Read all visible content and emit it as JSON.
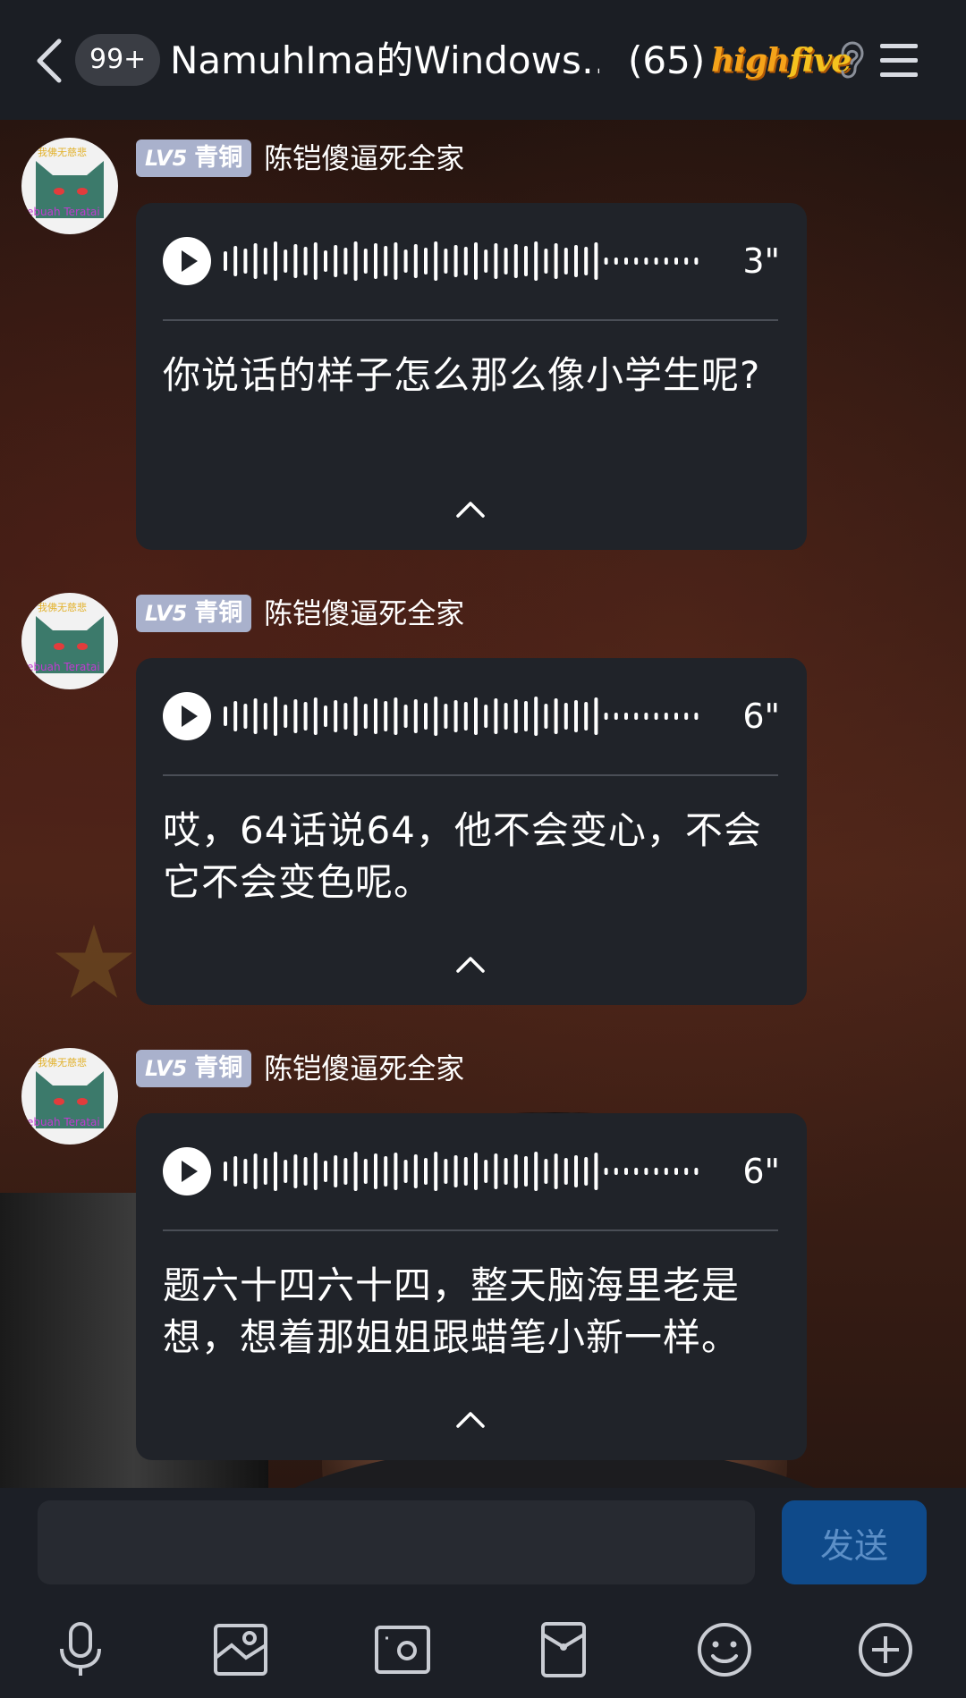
{
  "header": {
    "badge": "99+",
    "title": "NamuhIma的Windows…",
    "count": "(65)",
    "highfive_high": "high",
    "highfive_five": "five"
  },
  "messages": [
    {
      "avatar_top": "我佛无慈悲",
      "avatar_bottom": "ebuah Teratai",
      "level_lv": "LV5",
      "level_name": "青铜",
      "username": "陈铠傻逼死全家",
      "duration": "3\"",
      "transcript": "你说话的样子怎么那么像小学生呢?"
    },
    {
      "avatar_top": "我佛无慈悲",
      "avatar_bottom": "ebuah Teratai",
      "level_lv": "LV5",
      "level_name": "青铜",
      "username": "陈铠傻逼死全家",
      "duration": "6\"",
      "transcript": "哎，64话说64，他不会变心，不会它不会变色呢。"
    },
    {
      "avatar_top": "我佛无慈悲",
      "avatar_bottom": "ebuah Teratai",
      "level_lv": "LV5",
      "level_name": "青铜",
      "username": "陈铠傻逼死全家",
      "duration": "6\"",
      "transcript": "题六十四六十四，整天脑海里老是想，想着那姐姐跟蜡笔小新一样。"
    }
  ],
  "composer": {
    "input_value": "",
    "send_label": "发送"
  },
  "toolbar": [
    "microphone-icon",
    "image-icon",
    "camera-icon",
    "red-packet-icon",
    "emoji-icon",
    "plus-icon"
  ],
  "colors": {
    "header_bg": "#1b1e24",
    "bubble_bg": "#202329",
    "level_badge": "#a9b1cc",
    "send_button": "#0f4a8a",
    "brand_orange": "#f5a31a"
  }
}
